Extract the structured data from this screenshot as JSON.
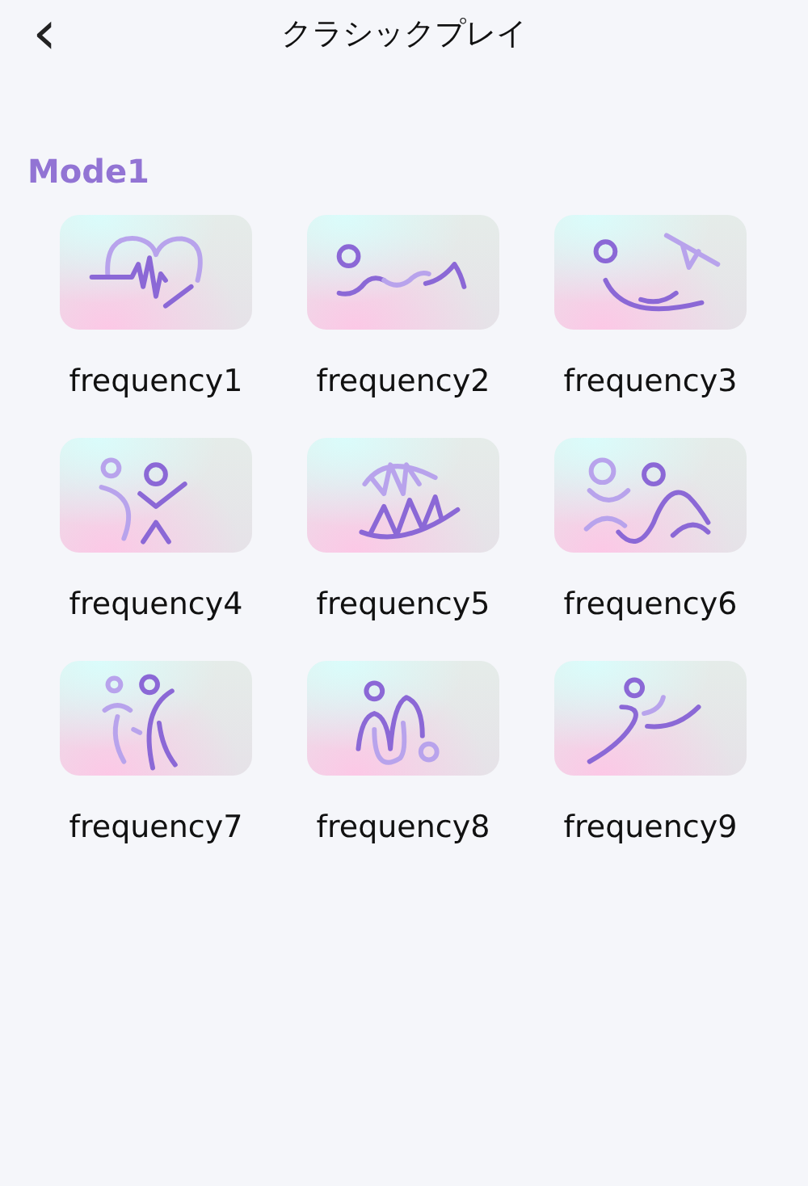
{
  "header": {
    "back": "‹",
    "title": "クラシックプレイ"
  },
  "section": {
    "title": "Mode1"
  },
  "items": [
    {
      "label": "frequency1"
    },
    {
      "label": "frequency2"
    },
    {
      "label": "frequency3"
    },
    {
      "label": "frequency4"
    },
    {
      "label": "frequency5"
    },
    {
      "label": "frequency6"
    },
    {
      "label": "frequency7"
    },
    {
      "label": "frequency8"
    },
    {
      "label": "frequency9"
    }
  ]
}
